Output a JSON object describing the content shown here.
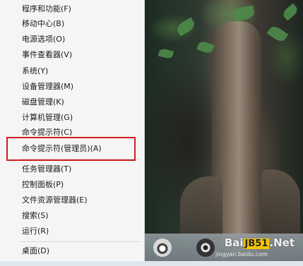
{
  "menu": {
    "items": [
      {
        "label": "程序和功能(F)"
      },
      {
        "label": "移动中心(B)"
      },
      {
        "label": "电源选项(O)"
      },
      {
        "label": "事件查看器(V)"
      },
      {
        "label": "系统(Y)"
      },
      {
        "label": "设备管理器(M)"
      },
      {
        "label": "磁盘管理(K)"
      },
      {
        "label": "计算机管理(G)"
      },
      {
        "label": "命令提示符(C)"
      },
      {
        "label": "命令提示符(管理员)(A)"
      },
      {
        "label": "任务管理器(T)"
      },
      {
        "label": "控制面板(P)"
      },
      {
        "label": "文件资源管理器(E)"
      },
      {
        "label": "搜索(S)"
      },
      {
        "label": "运行(R)"
      },
      {
        "label": "桌面(D)"
      }
    ],
    "highlighted_item": "命令提示符(管理员)(A)",
    "highlight_color": "#d21e1e"
  },
  "taskbar": {
    "icons": [
      "camera-icon",
      "film-reel-icon"
    ]
  },
  "watermark": {
    "main_prefix": "Bai",
    "badge": "JB51",
    "suffix": ".Net",
    "sub": "jingyan.baidu.com"
  }
}
